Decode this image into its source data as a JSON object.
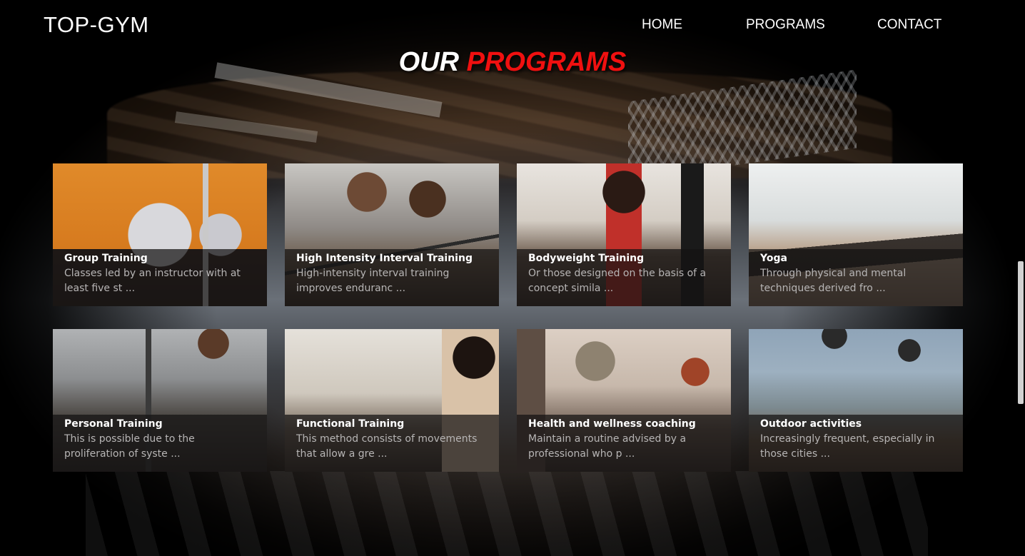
{
  "nav": {
    "logo": "TOP-GYM",
    "links": [
      "HOME",
      "PROGRAMS",
      "CONTACT"
    ]
  },
  "heading": {
    "word1": "OUR",
    "word2": "PROGRAMS",
    "accent_color": "#f01010"
  },
  "programs": [
    {
      "title": "Group Training",
      "desc": "Classes led by an instructor with at least five st ..."
    },
    {
      "title": "High Intensity Interval Training",
      "desc": "High-intensity interval training improves enduranc ..."
    },
    {
      "title": "Bodyweight Training",
      "desc": "Or those designed on the basis of a concept simila ..."
    },
    {
      "title": "Yoga",
      "desc": "Through physical and mental techniques derived fro ..."
    },
    {
      "title": "Personal Training",
      "desc": "This is possible due to the proliferation of syste ..."
    },
    {
      "title": "Functional Training",
      "desc": "This method consists of movements that allow a gre ..."
    },
    {
      "title": "Health and wellness coaching",
      "desc": "Maintain a routine advised by a professional who p ..."
    },
    {
      "title": "Outdoor activities",
      "desc": "Increasingly frequent, especially in those cities ..."
    }
  ]
}
